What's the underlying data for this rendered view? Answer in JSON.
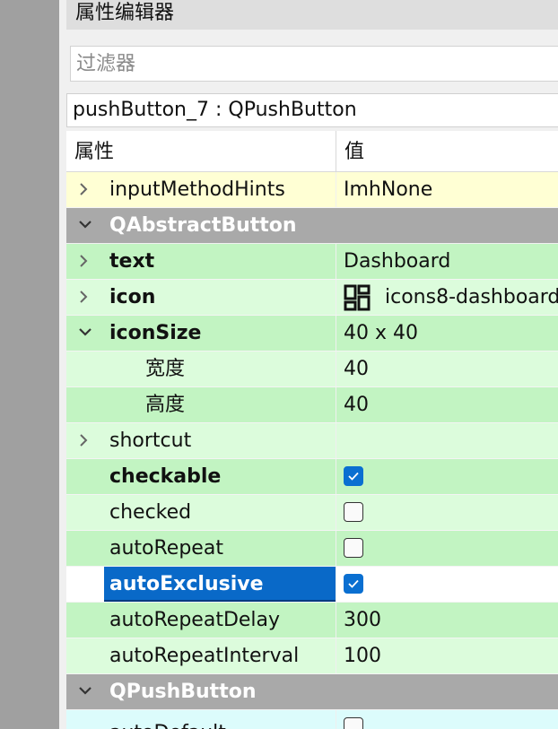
{
  "panel": {
    "title": "属性编辑器",
    "filter_placeholder": "过滤器",
    "object_label": "pushButton_7 : QPushButton"
  },
  "tree": {
    "headers": {
      "property": "属性",
      "value": "值"
    },
    "rows": [
      {
        "name": "inputMethodHints",
        "value": "ImhNone"
      },
      {
        "name": "QAbstractButton"
      },
      {
        "name": "text",
        "value": "Dashboard"
      },
      {
        "name": "icon",
        "value": "icons8-dashboard",
        "icon": "dashboard-icon"
      },
      {
        "name": "iconSize",
        "value": "40 x 40"
      },
      {
        "name": "宽度",
        "value": "40"
      },
      {
        "name": "高度",
        "value": "40"
      },
      {
        "name": "shortcut",
        "value": ""
      },
      {
        "name": "checkable",
        "checked": true
      },
      {
        "name": "checked",
        "checked": false
      },
      {
        "name": "autoRepeat",
        "checked": false
      },
      {
        "name": "autoExclusive",
        "checked": true
      },
      {
        "name": "autoRepeatDelay",
        "value": "300"
      },
      {
        "name": "autoRepeatInterval",
        "value": "100"
      },
      {
        "name": "QPushButton"
      },
      {
        "name": "autoDefault",
        "checked": false
      }
    ]
  },
  "colors": {
    "selection": "#0969c8",
    "checkbox_checked": "#0a6fd1",
    "group_header": "#a9a9a9",
    "row_light": "#dcfcdc",
    "row_dark": "#c2f4c2",
    "row_yellow": "#ffffd4",
    "row_cyan": "#dcfcfc"
  }
}
